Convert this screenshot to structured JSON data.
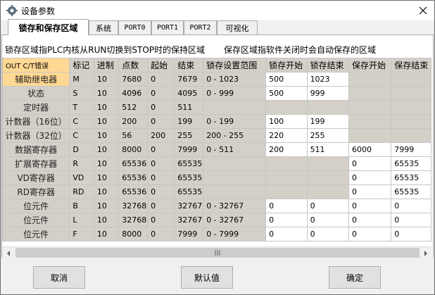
{
  "window": {
    "title": "设备参数"
  },
  "tabs": [
    {
      "label": "锁存和保存区域"
    },
    {
      "label": "系统"
    },
    {
      "label": "PORT0"
    },
    {
      "label": "PORT1"
    },
    {
      "label": "PORT2"
    },
    {
      "label": "可视化"
    }
  ],
  "descriptions": {
    "latch": "锁存区域指PLC内核从RUN切换到STOP时的保持区域",
    "save": "保存区域指软件关闭时会自动保存的区域"
  },
  "grid": {
    "corner": "OUT C/T错误",
    "columns": [
      "标记",
      "进制",
      "点数",
      "起始",
      "结束",
      "锁存设置范围",
      "锁存开始",
      "锁存结束",
      "保存开始",
      "保存结束"
    ],
    "rows": [
      {
        "name": "辅助继电器",
        "cells": [
          "M",
          "10",
          "7680",
          "0",
          "7679",
          "0 - 1023",
          "500",
          "1023",
          "",
          ""
        ]
      },
      {
        "name": "状态",
        "cells": [
          "S",
          "10",
          "4096",
          "0",
          "4095",
          "0 - 999",
          "500",
          "999",
          "",
          ""
        ]
      },
      {
        "name": "定时器",
        "cells": [
          "T",
          "10",
          "512",
          "0",
          "511",
          "",
          "",
          "",
          "",
          ""
        ]
      },
      {
        "name": "计数器（16位）",
        "cells": [
          "C",
          "10",
          "200",
          "0",
          "199",
          "0 - 199",
          "100",
          "199",
          "",
          ""
        ]
      },
      {
        "name": "计数器（32位）",
        "cells": [
          "C",
          "10",
          "56",
          "200",
          "255",
          "200 - 255",
          "220",
          "255",
          "",
          ""
        ]
      },
      {
        "name": "数据寄存器",
        "cells": [
          "D",
          "10",
          "8000",
          "0",
          "7999",
          "0 - 511",
          "200",
          "511",
          "6000",
          "7999"
        ]
      },
      {
        "name": "扩展寄存器",
        "cells": [
          "R",
          "10",
          "65536",
          "0",
          "65535",
          "",
          "",
          "",
          "0",
          "65535"
        ]
      },
      {
        "name": "VD寄存器",
        "cells": [
          "VD",
          "10",
          "65536",
          "0",
          "65535",
          "",
          "",
          "",
          "0",
          "65535"
        ]
      },
      {
        "name": "RD寄存器",
        "cells": [
          "RD",
          "10",
          "65536",
          "0",
          "65535",
          "",
          "",
          "",
          "0",
          "65535"
        ]
      },
      {
        "name": "位元件",
        "cells": [
          "B",
          "10",
          "32768",
          "0",
          "32767",
          "0 - 32767",
          "0",
          "0",
          "0",
          "0"
        ]
      },
      {
        "name": "位元件",
        "cells": [
          "L",
          "10",
          "32768",
          "0",
          "32767",
          "0 - 32767",
          "0",
          "0",
          "0",
          "0"
        ]
      },
      {
        "name": "位元件",
        "cells": [
          "F",
          "10",
          "8000",
          "0",
          "7999",
          "0 - 7999",
          "0",
          "0",
          "0",
          "0"
        ]
      }
    ],
    "editable": [
      [
        0,
        0,
        0,
        0,
        0,
        0,
        1,
        1,
        0,
        0
      ],
      [
        0,
        0,
        0,
        0,
        0,
        0,
        1,
        1,
        0,
        0
      ],
      [
        0,
        0,
        0,
        0,
        0,
        0,
        0,
        0,
        0,
        0
      ],
      [
        0,
        0,
        0,
        0,
        0,
        0,
        1,
        1,
        0,
        0
      ],
      [
        0,
        0,
        0,
        0,
        0,
        0,
        1,
        1,
        0,
        0
      ],
      [
        0,
        0,
        0,
        0,
        0,
        0,
        1,
        1,
        1,
        1
      ],
      [
        0,
        0,
        0,
        0,
        0,
        0,
        0,
        0,
        1,
        1
      ],
      [
        0,
        0,
        0,
        0,
        0,
        0,
        0,
        0,
        1,
        1
      ],
      [
        0,
        0,
        0,
        0,
        0,
        0,
        0,
        0,
        1,
        1
      ],
      [
        0,
        0,
        0,
        0,
        0,
        0,
        1,
        1,
        1,
        1
      ],
      [
        0,
        0,
        0,
        0,
        0,
        0,
        1,
        1,
        1,
        1
      ],
      [
        0,
        0,
        0,
        0,
        0,
        0,
        1,
        1,
        1,
        1
      ]
    ],
    "selected_row": 0
  },
  "buttons": {
    "cancel": "取消",
    "default": "默认值",
    "ok": "确定"
  },
  "icons": {
    "app": "gear-icon",
    "close": "close-icon"
  }
}
